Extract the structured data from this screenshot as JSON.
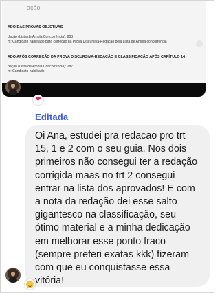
{
  "attachment": {
    "top_text": "ação",
    "lines": [
      {
        "kind": "head",
        "text": "ADO DAS PROVAS OBJETIVAS"
      },
      {
        "kind": "text",
        "text": "dação (Lista de Ampla Concorrência): 903"
      },
      {
        "kind": "text",
        "text": "m: Candidato habilitado para correção da Prova Discursiva-Redação pela Lista de Ampla concorrência"
      },
      {
        "kind": "head",
        "text": "ADO APÓS CORREÇÃO DA PROVA DISCURSIVA-REDAÇÃO E CLASSIFICAÇÃO APÓS CAPÍTULO 14"
      },
      {
        "kind": "text",
        "text": "dação (Lista de Ampla Concorrência): 287"
      },
      {
        "kind": "text",
        "text": "m: Candidato habilitado."
      }
    ]
  },
  "reactions": {
    "first": "heart",
    "second": "grimacing-face"
  },
  "edited_label": "Editada",
  "message": {
    "text": "Oi Ana, estudei pra redacao pro trt\n15,  1 e 2 com o seu guia. Nos dois\nprimeiros não consegui ter a redação\ncorrigida maas no trt 2 consegui\nentrar na lista dos aprovados! E com\na nota da redação dei esse salto\ngigantesco na classificação, seu\nótimo material e a minha dedicação\nem melhorar esse ponto fraco\n(sempre preferi exatas kkk) fizeram\ncom que eu conquistasse essa\nvitória!"
  },
  "colors": {
    "edited": "#3b5bd6",
    "bubble": "#f0f0f0",
    "heart": "#e0245e"
  }
}
